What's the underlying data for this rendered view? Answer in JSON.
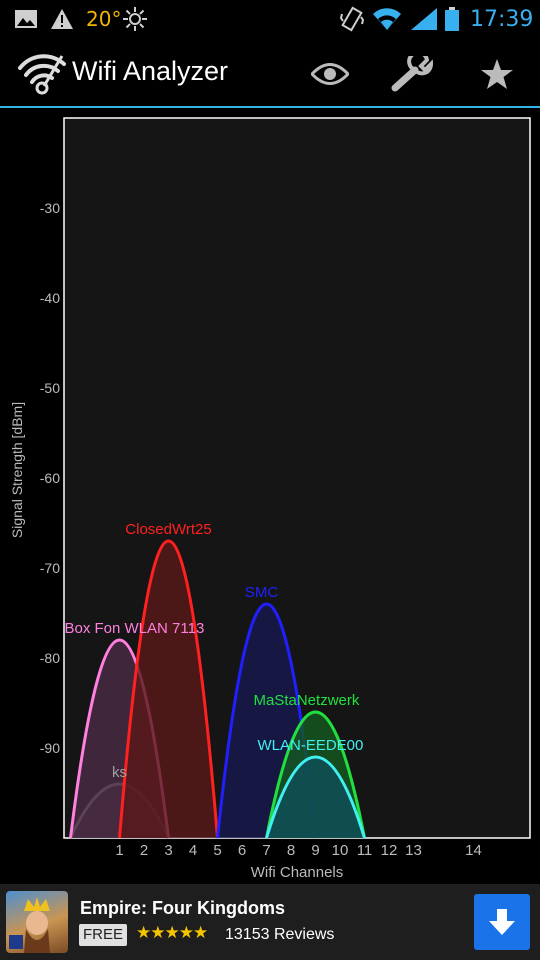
{
  "status_bar": {
    "temperature": "20°",
    "time": "17:39",
    "icons": [
      "image-icon",
      "warning-icon",
      "brightness-icon",
      "vibrate-icon",
      "wifi-icon",
      "signal-icon",
      "battery-icon"
    ]
  },
  "action_bar": {
    "title": "Wifi Analyzer",
    "icons": [
      "eye-icon",
      "wrench-icon",
      "star-icon"
    ]
  },
  "colors": {
    "accent": "#33b5e5",
    "plot_background": "#151515"
  },
  "chart_data": {
    "type": "area",
    "xlabel": "Wifi Channels",
    "ylabel": "Signal Strength [dBm]",
    "ytick_labels": [
      "-30",
      "-40",
      "-50",
      "-60",
      "-70",
      "-80",
      "-90"
    ],
    "yticks": [
      -30,
      -40,
      -50,
      -60,
      -70,
      -80,
      -90
    ],
    "xtick_labels": [
      "1",
      "2",
      "3",
      "4",
      "5",
      "6",
      "7",
      "8",
      "9",
      "10",
      "11",
      "12",
      "13",
      "14"
    ],
    "xticks": [
      1,
      2,
      3,
      4,
      5,
      6,
      7,
      8,
      9,
      10,
      11,
      12,
      13,
      14
    ],
    "ylim": [
      -100,
      -20
    ],
    "xlim": [
      -1,
      17
    ],
    "grid": false,
    "series": [
      {
        "name": "ks",
        "channel": 1,
        "strength": -94,
        "color": "#a0a0a0",
        "fill": "#3a2f3c"
      },
      {
        "name": "Box Fon WLAN 7113",
        "channel": 1,
        "strength": -78,
        "color": "#ff80e0",
        "fill": "#4a2a44"
      },
      {
        "name": "ClosedWrt25",
        "channel": 3,
        "strength": -67,
        "color": "#ff2020",
        "fill": "#5a1818"
      },
      {
        "name": "SMC",
        "channel": 7,
        "strength": -74,
        "color": "#2020ff",
        "fill": "#181850"
      },
      {
        "name": "MaStaNetzwerk",
        "channel": 9,
        "strength": -86,
        "color": "#20e040",
        "fill": "#145a20"
      },
      {
        "name": "WLAN-EEDE00",
        "channel": 9,
        "strength": -91,
        "color": "#40f0f0",
        "fill": "#0e4e5a"
      }
    ]
  },
  "ad": {
    "title": "Empire: Four Kingdoms",
    "badge": "FREE",
    "stars": "★★★★★",
    "rating": 4.5,
    "reviews": "13153 Reviews"
  }
}
